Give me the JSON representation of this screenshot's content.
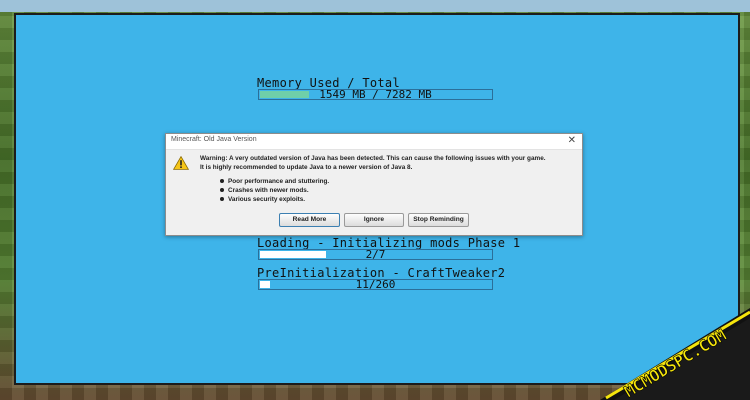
{
  "memory": {
    "label": "Memory Used / Total",
    "bar_text": "1549 MB / 7282 MB",
    "used_mb": 1549,
    "total_mb": 7282,
    "fill_color": "#6fcfa9"
  },
  "dialog": {
    "title": "Minecraft: Old Java Version",
    "close_glyph": "✕",
    "icon": "warning-icon",
    "message_line1": "Warning: A very outdated version of Java has been detected. This can cause the following issues with your game.",
    "message_line2": "It is highly recommended to update Java to a newer version of Java 8.",
    "issues": [
      "Poor performance and stuttering.",
      "Crashes with newer mods.",
      "Various security exploits."
    ],
    "buttons": {
      "read_more": "Read More",
      "ignore": "Ignore",
      "stop_reminding": "Stop Reminding"
    }
  },
  "loading": {
    "label": "Loading - Initializing mods Phase 1",
    "bar_text": "2/7",
    "current": 2,
    "total": 7
  },
  "preinit": {
    "label": "PreInitialization - CraftTweaker2",
    "bar_text": "11/260",
    "current": 11,
    "total": 260
  },
  "watermark": {
    "text": "MCMODSPC.COM",
    "color": "#f5e50c"
  },
  "colors": {
    "loading_bg": "#3eb4e9",
    "bar_fill_white": "#ffffff"
  }
}
